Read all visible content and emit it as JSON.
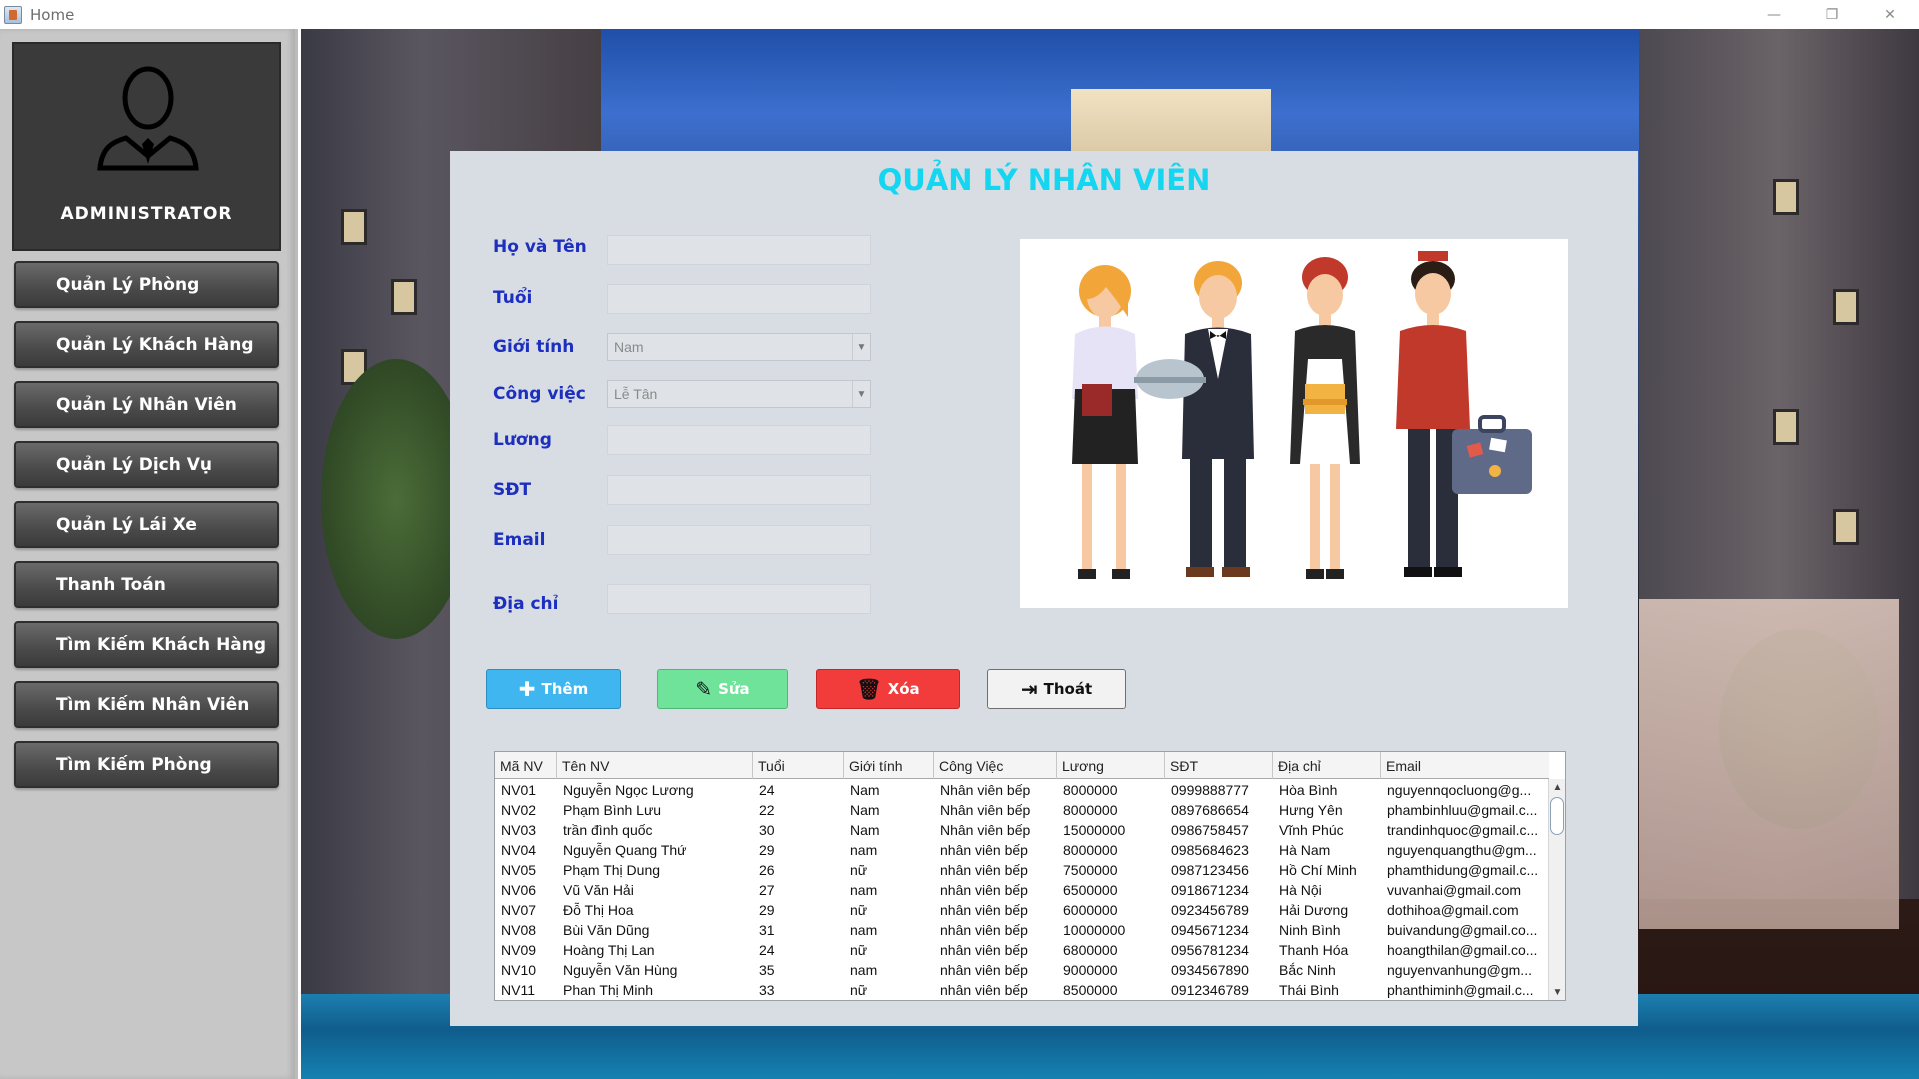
{
  "window": {
    "title": "Home",
    "minimize": "—",
    "maximize": "❐",
    "close": "✕"
  },
  "sidebar": {
    "admin_label": "ADMINISTRATOR",
    "items": [
      {
        "label": "Quản Lý Phòng"
      },
      {
        "label": "Quản Lý Khách Hàng"
      },
      {
        "label": "Quản Lý Nhân Viên"
      },
      {
        "label": "Quản Lý Dịch Vụ"
      },
      {
        "label": "Quản Lý Lái Xe"
      },
      {
        "label": "Thanh Toán"
      },
      {
        "label": "Tìm Kiếm Khách Hàng"
      },
      {
        "label": "Tìm Kiếm Nhân Viên"
      },
      {
        "label": "Tìm Kiếm Phòng"
      }
    ]
  },
  "form": {
    "title": "QUẢN LÝ NHÂN VIÊN",
    "labels": {
      "name": "Họ và Tên",
      "age": "Tuổi",
      "gender": "Giới tính",
      "job": "Công việc",
      "salary": "Lương",
      "phone": "SĐT",
      "email": "Email",
      "address": "Địa chỉ"
    },
    "values": {
      "name": "",
      "age": "",
      "gender": "Nam",
      "job": "Lễ Tân",
      "salary": "",
      "phone": "",
      "email": "",
      "address": ""
    }
  },
  "actions": {
    "add": "Thêm",
    "edit": "Sửa",
    "delete": "Xóa",
    "exit": "Thoát"
  },
  "colors": {
    "title": "#15d6f0",
    "label": "#1c2fbf",
    "add": "#3fb6f0",
    "edit": "#6fe39a",
    "delete": "#f23b3b",
    "exit": "#f2f2f2"
  },
  "table": {
    "headers": [
      "Mã NV",
      "Tên NV",
      "Tuổi",
      "Giới tính",
      "Công Việc",
      "Lương",
      "SĐT",
      "Địa chỉ",
      "Email"
    ],
    "rows": [
      [
        "NV01",
        "Nguyễn Ngọc Lương",
        "24",
        "Nam",
        "Nhân viên bếp",
        "8000000",
        "0999888777",
        "Hòa Bình",
        "nguyennqocluong@g..."
      ],
      [
        "NV02",
        "Phạm Bình Lưu",
        "22",
        "Nam",
        "Nhân viên bếp",
        "8000000",
        "0897686654",
        "Hưng Yên",
        "phambinhluu@gmail.c..."
      ],
      [
        "NV03",
        "trần đình quốc",
        "30",
        "Nam",
        "Nhân viên bếp",
        "15000000",
        "0986758457",
        "Vĩnh Phúc",
        "trandinhquoc@gmail.c..."
      ],
      [
        "NV04",
        "Nguyễn Quang Thứ",
        "29",
        "nam",
        "nhân viên bếp",
        "8000000",
        "0985684623",
        "Hà Nam",
        "nguyenquangthu@gm..."
      ],
      [
        "NV05",
        "Phạm Thị Dung",
        "26",
        "nữ",
        "nhân viên bếp",
        "7500000",
        "0987123456",
        "Hồ Chí Minh",
        "phamthidung@gmail.c..."
      ],
      [
        "NV06",
        "Vũ Văn Hải",
        "27",
        "nam",
        "nhân viên bếp",
        "6500000",
        "0918671234",
        "Hà Nội",
        "vuvanhai@gmail.com"
      ],
      [
        "NV07",
        "Đỗ Thị Hoa",
        "29",
        "nữ",
        "nhân viên bếp",
        "6000000",
        "0923456789",
        "Hải Dương",
        "dothihoa@gmail.com"
      ],
      [
        "NV08",
        "Bùi Văn Dũng",
        "31",
        "nam",
        "nhân viên bếp",
        "10000000",
        "0945671234",
        "Ninh Bình",
        "buivandung@gmail.co..."
      ],
      [
        "NV09",
        "Hoàng Thị Lan",
        "24",
        "nữ",
        "nhân viên bếp",
        "6800000",
        "0956781234",
        "Thanh Hóa",
        "hoangthilan@gmail.co..."
      ],
      [
        "NV10",
        "Nguyễn Văn Hùng",
        "35",
        "nam",
        "nhân viên bếp",
        "9000000",
        "0934567890",
        "Bắc Ninh",
        "nguyenvanhung@gm..."
      ],
      [
        "NV11",
        "Phan Thị Minh",
        "33",
        "nữ",
        "nhân viên bếp",
        "8500000",
        "0912346789",
        "Thái Bình",
        "phanthiminh@gmail.c..."
      ]
    ]
  }
}
